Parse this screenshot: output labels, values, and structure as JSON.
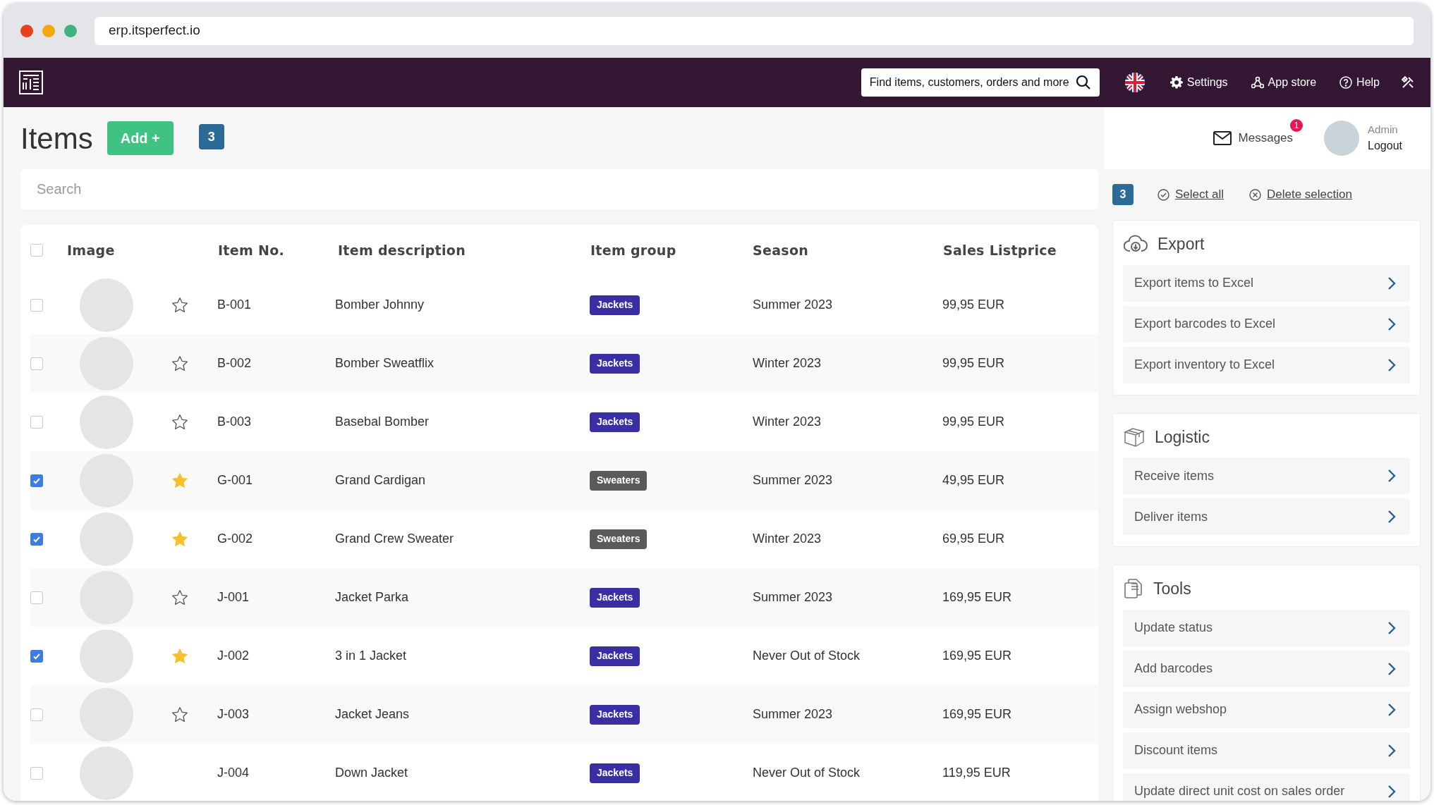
{
  "browser": {
    "url": "erp.itsperfect.io"
  },
  "navbar": {
    "search_placeholder": "Find items, customers, orders and more",
    "links": [
      {
        "label": "Settings"
      },
      {
        "label": "App store"
      },
      {
        "label": "Help"
      }
    ]
  },
  "header": {
    "title": "Items",
    "add_button": "Add +",
    "selection_count": "3"
  },
  "user": {
    "messages_label": "Messages",
    "unread_badge": "1",
    "name": "Admin",
    "logout": "Logout"
  },
  "search": {
    "placeholder": "Search"
  },
  "table": {
    "all_checked": false,
    "columns": [
      "Image",
      "Item No.",
      "Item description",
      "Item group",
      "Season",
      "Sales Listprice"
    ],
    "rows": [
      {
        "checked": false,
        "favorite": false,
        "item_no": "B-001",
        "description": "Bomber Johnny",
        "group": {
          "label": "Jackets",
          "color": "#3a2ea3"
        },
        "season": "Summer 2023",
        "price": "99,95 EUR"
      },
      {
        "checked": false,
        "favorite": false,
        "item_no": "B-002",
        "description": "Bomber Sweatflix",
        "group": {
          "label": "Jackets",
          "color": "#3a2ea3"
        },
        "season": "Winter 2023",
        "price": "99,95 EUR"
      },
      {
        "checked": false,
        "favorite": false,
        "item_no": "B-003",
        "description": "Basebal Bomber",
        "group": {
          "label": "Jackets",
          "color": "#3a2ea3"
        },
        "season": "Winter 2023",
        "price": "99,95 EUR"
      },
      {
        "checked": true,
        "favorite": true,
        "item_no": "G-001",
        "description": "Grand Cardigan",
        "group": {
          "label": "Sweaters",
          "color": "#5a5a5a"
        },
        "season": "Summer 2023",
        "price": "49,95 EUR"
      },
      {
        "checked": true,
        "favorite": true,
        "item_no": "G-002",
        "description": "Grand Crew Sweater",
        "group": {
          "label": "Sweaters",
          "color": "#5a5a5a"
        },
        "season": "Winter 2023",
        "price": "69,95 EUR"
      },
      {
        "checked": false,
        "favorite": false,
        "item_no": "J-001",
        "description": "Jacket Parka",
        "group": {
          "label": "Jackets",
          "color": "#3a2ea3"
        },
        "season": "Summer 2023",
        "price": "169,95 EUR"
      },
      {
        "checked": true,
        "favorite": true,
        "item_no": "J-002",
        "description": "3 in 1 Jacket",
        "group": {
          "label": "Jackets",
          "color": "#3a2ea3"
        },
        "season": "Never Out of Stock",
        "price": "169,95 EUR"
      },
      {
        "checked": false,
        "favorite": false,
        "item_no": "J-003",
        "description": "Jacket Jeans",
        "group": {
          "label": "Jackets",
          "color": "#3a2ea3"
        },
        "season": "Summer 2023",
        "price": "169,95 EUR"
      },
      {
        "checked": false,
        "item_no": "J-004",
        "description": "Down Jacket",
        "group": {
          "label": "Jackets",
          "color": "#3a2ea3"
        },
        "season": "Never Out of Stock",
        "price": "119,95 EUR"
      }
    ]
  },
  "selection_bar": {
    "count": "3",
    "select_all": "Select all",
    "delete_selection": "Delete selection"
  },
  "panels": [
    {
      "title": "Export",
      "actions": [
        "Export items to Excel",
        "Export barcodes to Excel",
        "Export inventory to Excel"
      ]
    },
    {
      "title": "Logistic",
      "actions": [
        "Receive items",
        "Deliver items"
      ]
    },
    {
      "title": "Tools",
      "actions": [
        "Update status",
        "Add barcodes",
        "Assign webshop",
        "Discount items",
        "Update direct unit cost on sales order"
      ]
    }
  ]
}
